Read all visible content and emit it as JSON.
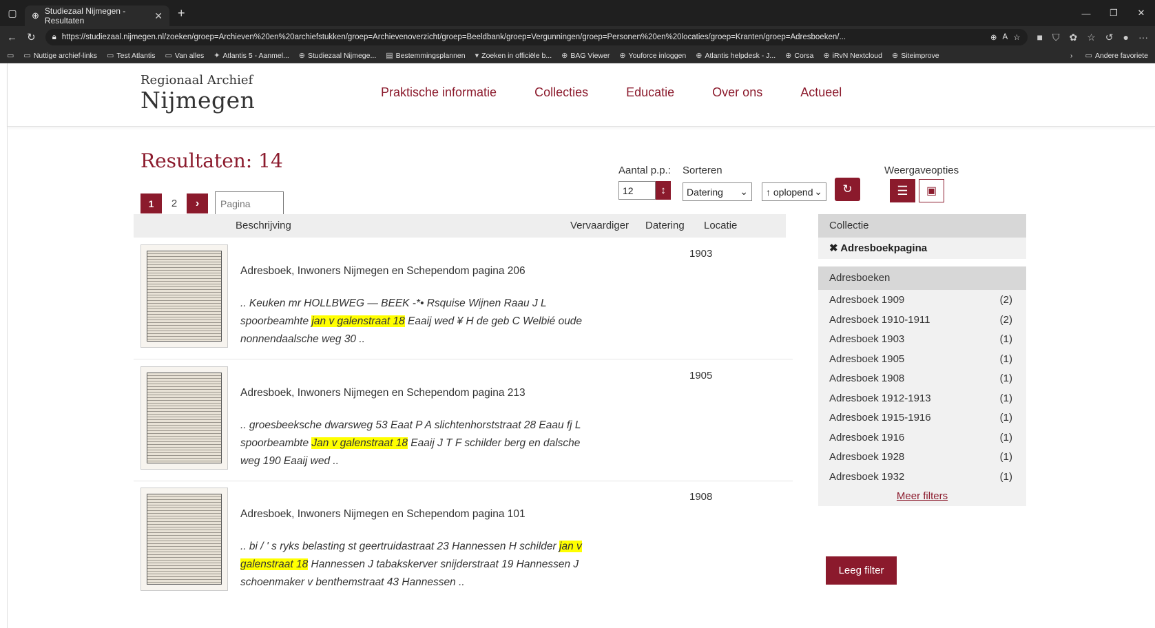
{
  "browser": {
    "tab_title": "Studiezaal Nijmegen - Resultaten",
    "url": "https://studiezaal.nijmegen.nl/zoeken/groep=Archieven%20en%20archiefstukken/groep=Archievenoverzicht/groep=Beeldbank/groep=Vergunningen/groep=Personen%20en%20locaties/groep=Kranten/groep=Adresboeken/...",
    "bookmarks": [
      "Nuttige archief-links",
      "Test Atlantis",
      "Van alles",
      "Atlantis 5 - Aanmel...",
      "Studiezaal Nijmege...",
      "Bestemmingsplannen",
      "Zoeken in officiële b...",
      "BAG Viewer",
      "Youforce inloggen",
      "Atlantis helpdesk - J...",
      "Corsa",
      "iRvN Nextcloud",
      "Siteimprove"
    ],
    "bookmarks_other": "Andere favoriete"
  },
  "site": {
    "logo_top": "Regionaal Archief",
    "logo_main": "Nijmegen",
    "nav": [
      "Praktische informatie",
      "Collecties",
      "Educatie",
      "Over ons",
      "Actueel"
    ]
  },
  "results": {
    "title": "Resultaten: 14",
    "pager": {
      "current": "1",
      "next_page": "2",
      "page_placeholder": "Pagina"
    },
    "per_page_label": "Aantal p.p.:",
    "per_page_value": "12",
    "sort_label": "Sorteren",
    "sort_value": "Datering",
    "order_value": "↑ oplopend",
    "view_label": "Weergaveopties",
    "columns": [
      "Beschrijving",
      "Vervaardiger",
      "Datering",
      "Locatie"
    ],
    "items": [
      {
        "title": "Adresboek, Inwoners Nijmegen en Schependom pagina 206",
        "date": "1903",
        "snippet_pre": ".. Keuken mr HOLLBWEG — BEEK -*• Rsquise Wijnen Raau J L spoorbeamhte ",
        "snippet_hl": "jan v galenstraat 18",
        "snippet_post": " Eaaij wed ¥ H de geb C Welbié oude nonnendaalsche weg 30 .."
      },
      {
        "title": "Adresboek, Inwoners Nijmegen en Schependom pagina 213",
        "date": "1905",
        "snippet_pre": ".. groesbeeksche dwarsweg 53 Eaat P A slichtenhorststraat 28 Eaau fj L spoorbeambte ",
        "snippet_hl": "Jan v galenstraat 18",
        "snippet_post": " Eaaij J T F schilder berg en dalsche weg 190 Eaaij wed .."
      },
      {
        "title": "Adresboek, Inwoners Nijmegen en Schependom pagina 101",
        "date": "1908",
        "snippet_pre": ".. bi / ' s ryks belasting st geertruidastraat 23 Hannessen H schilder ",
        "snippet_hl": "jan v galenstraat 18",
        "snippet_post": " Hannessen J tabakskerver snijderstraat 19 Hannessen J schoenmaker v benthemstraat 43 Hannessen .."
      }
    ]
  },
  "sidebar": {
    "collectie_head": "Collectie",
    "collectie_active": "Adresboekpagina",
    "adresboeken_head": "Adresboeken",
    "facets": [
      {
        "label": "Adresboek 1909",
        "count": "(2)"
      },
      {
        "label": "Adresboek 1910-1911",
        "count": "(2)"
      },
      {
        "label": "Adresboek 1903",
        "count": "(1)"
      },
      {
        "label": "Adresboek 1905",
        "count": "(1)"
      },
      {
        "label": "Adresboek 1908",
        "count": "(1)"
      },
      {
        "label": "Adresboek 1912-1913",
        "count": "(1)"
      },
      {
        "label": "Adresboek 1915-1916",
        "count": "(1)"
      },
      {
        "label": "Adresboek 1916",
        "count": "(1)"
      },
      {
        "label": "Adresboek 1928",
        "count": "(1)"
      },
      {
        "label": "Adresboek 1932",
        "count": "(1)"
      }
    ],
    "more_filters": "Meer filters",
    "clear_filter": "Leeg filter"
  }
}
